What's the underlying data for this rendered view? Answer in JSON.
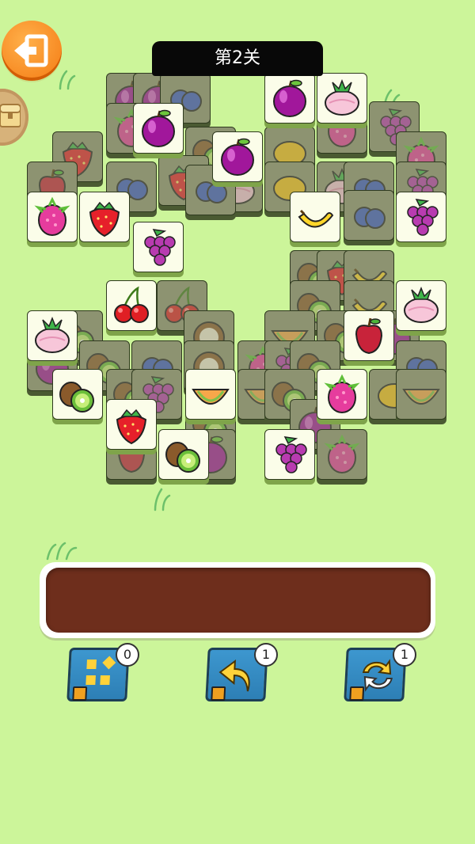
{
  "level": {
    "title": "第2关"
  },
  "tools": {
    "shuffle": {
      "count": "0"
    },
    "undo": {
      "count": "1"
    },
    "refresh": {
      "count": "1"
    }
  },
  "tiles_front": [
    {
      "fruit": "plum"
    },
    {
      "fruit": "turnip"
    },
    {
      "fruit": "plum"
    },
    {
      "fruit": "plum"
    },
    {
      "fruit": "dragonfruit"
    },
    {
      "fruit": "strawberry"
    },
    {
      "fruit": "banana"
    },
    {
      "fruit": "grape"
    },
    {
      "fruit": "grape"
    },
    {
      "fruit": "cherry"
    },
    {
      "fruit": "turnip"
    },
    {
      "fruit": "apple"
    },
    {
      "fruit": "turnip"
    },
    {
      "fruit": "kiwi"
    },
    {
      "fruit": "melon"
    },
    {
      "fruit": "dragonfruit"
    },
    {
      "fruit": "strawberry"
    },
    {
      "fruit": "kiwi"
    },
    {
      "fruit": "grape"
    }
  ]
}
